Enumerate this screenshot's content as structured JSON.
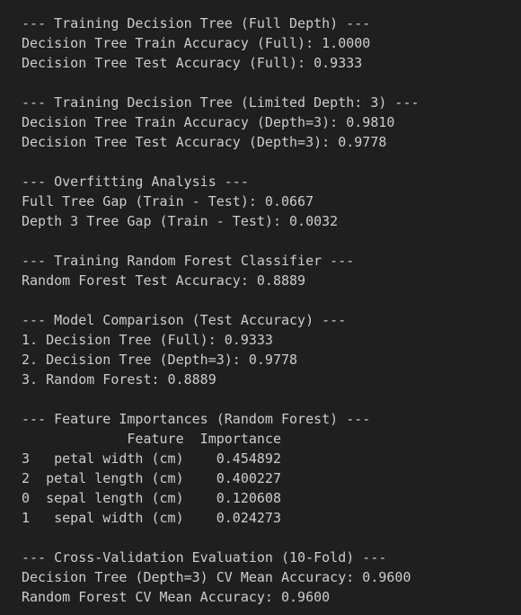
{
  "output_lines": [
    "--- Training Decision Tree (Full Depth) ---",
    "Decision Tree Train Accuracy (Full): 1.0000",
    "Decision Tree Test Accuracy (Full): 0.9333",
    "",
    "--- Training Decision Tree (Limited Depth: 3) ---",
    "Decision Tree Train Accuracy (Depth=3): 0.9810",
    "Decision Tree Test Accuracy (Depth=3): 0.9778",
    "",
    "--- Overfitting Analysis ---",
    "Full Tree Gap (Train - Test): 0.0667",
    "Depth 3 Tree Gap (Train - Test): 0.0032",
    "",
    "--- Training Random Forest Classifier ---",
    "Random Forest Test Accuracy: 0.8889",
    "",
    "--- Model Comparison (Test Accuracy) ---",
    "1. Decision Tree (Full): 0.9333",
    "2. Decision Tree (Depth=3): 0.9778",
    "3. Random Forest: 0.8889",
    "",
    "--- Feature Importances (Random Forest) ---",
    "             Feature  Importance",
    "3   petal width (cm)    0.454892",
    "2  petal length (cm)    0.400227",
    "0  sepal length (cm)    0.120608",
    "1   sepal width (cm)    0.024273",
    "",
    "--- Cross-Validation Evaluation (10-Fold) ---",
    "Decision Tree (Depth=3) CV Mean Accuracy: 0.9600",
    "Random Forest CV Mean Accuracy: 0.9600"
  ]
}
